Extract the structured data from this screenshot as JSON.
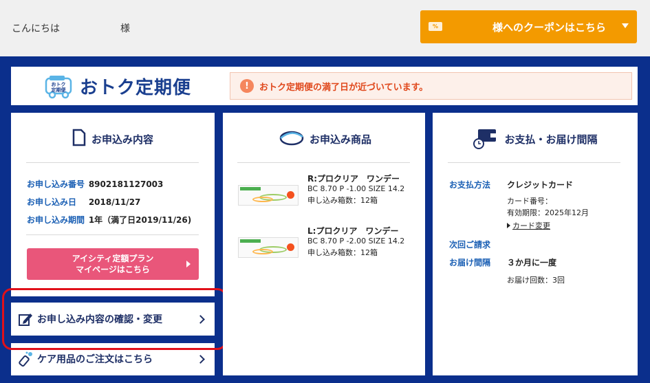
{
  "topbar": {
    "greeting": "こんにちは",
    "honorific": "様",
    "coupon_button": "様へのクーポンはこちら",
    "coupon_tag": "%"
  },
  "header": {
    "logo_text": "おトク定期便",
    "logo_badge": "おトク定期便",
    "alert_icon": "!",
    "alert": "おトク定期便の満了日が近づいています。"
  },
  "order_panel": {
    "title": "お申込み内容",
    "rows": [
      {
        "label": "お申し込み番号",
        "value": "8902181127003"
      },
      {
        "label": "お申し込み日",
        "value": "2018/11/27"
      },
      {
        "label": "お申し込み期間",
        "value": "1年（満了日2019/11/26)"
      }
    ],
    "plan_button_line1": "アイシティ定額プラン",
    "plan_button_line2": "マイページはこちら"
  },
  "menu": {
    "confirm_change": "お申し込み内容の確認・変更",
    "care_order": "ケア用品のご注文はこちら"
  },
  "products_panel": {
    "title": "お申込み商品",
    "items": [
      {
        "name": "R:プロクリア　ワンデー",
        "spec": "BC 8.70 P -1.00 SIZE 14.2",
        "qty": "申し込み箱数：12箱"
      },
      {
        "name": "L:プロクリア　ワンデー",
        "spec": "BC 8.70 P -2.00 SIZE 14.2",
        "qty": "申し込み箱数：12箱"
      }
    ]
  },
  "payment_panel": {
    "title": "お支払・お届け間隔",
    "method_label": "お支払方法",
    "method_value": "クレジットカード",
    "card_number": "カード番号：",
    "expiry": "有効期限：2025年12月",
    "card_change": "カード変更",
    "next_billing_label": "次回ご請求",
    "interval_label": "お届け間隔",
    "interval_value": "３か月に一度",
    "delivery_count": "お届け回数：3回"
  },
  "colors": {
    "frame": "#0b2f8c",
    "coupon": "#f39a00",
    "plan_button": "#e9567a",
    "alert_text": "#e0481c",
    "highlight": "#e0101a"
  },
  "icons": [
    "coupon-tag-icon",
    "delivery-car-icon",
    "document-icon",
    "contact-lens-icon",
    "wallet-clock-icon",
    "edit-pen-icon",
    "care-bottle-icon"
  ]
}
